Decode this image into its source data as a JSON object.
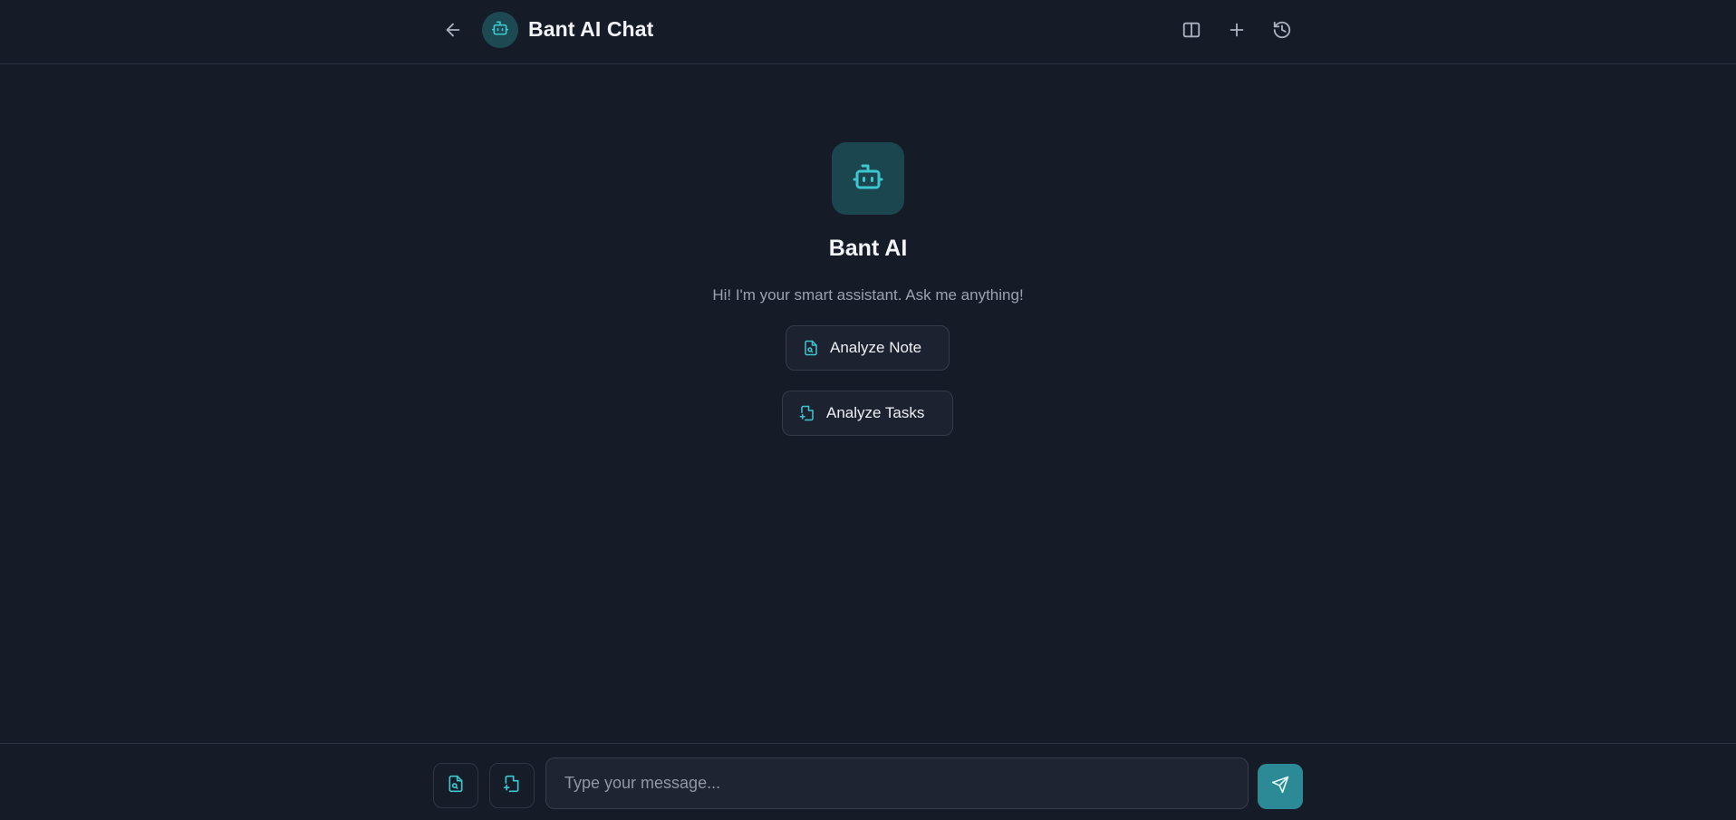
{
  "header": {
    "title": "Bant AI Chat",
    "back_icon": "arrow-left-icon",
    "avatar_icon": "bot-icon",
    "actions": [
      {
        "icon": "split-view-icon"
      },
      {
        "icon": "plus-icon"
      },
      {
        "icon": "history-icon"
      }
    ]
  },
  "welcome": {
    "title": "Bant AI",
    "subtitle": "Hi! I'm your smart assistant. Ask me anything!",
    "suggestions": [
      {
        "label": "Analyze Note",
        "icon": "file-search-icon"
      },
      {
        "label": "Analyze Tasks",
        "icon": "file-sparkle-icon"
      }
    ]
  },
  "composer": {
    "placeholder": "Type your message...",
    "value": "",
    "attach_note_icon": "file-search-icon",
    "attach_tasks_icon": "file-sparkle-icon",
    "send_icon": "send-icon"
  },
  "colors": {
    "background": "#161b28",
    "accent": "#2b8a96",
    "accent_icon": "#3ec6cf",
    "avatar_bg": "#1b4650"
  }
}
